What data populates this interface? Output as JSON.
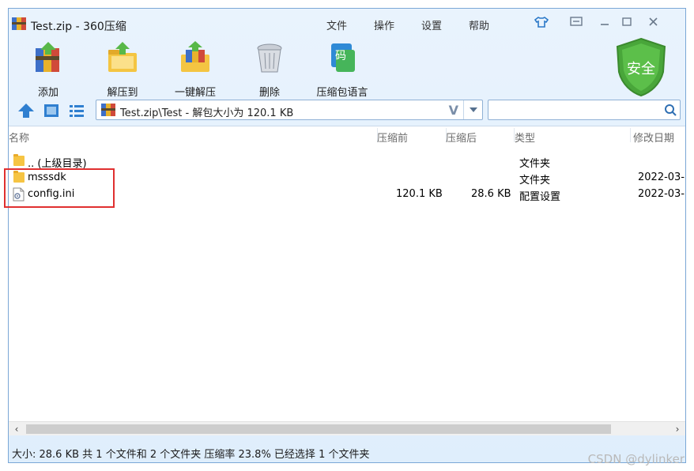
{
  "window": {
    "title": "Test.zip - 360压缩",
    "menu": [
      "文件",
      "操作",
      "设置",
      "帮助"
    ]
  },
  "toolbar": {
    "add": "添加",
    "extract_to": "解压到",
    "one_click_extract": "一键解压",
    "delete": "删除",
    "compress_language": "压缩包语言",
    "security_badge": "安全"
  },
  "address_bar": {
    "path": "Test.zip\\Test - 解包大小为 120.1 KB",
    "v_marker": "V",
    "search_placeholder": ""
  },
  "columns": {
    "name": "名称",
    "before": "压缩前",
    "after": "压缩后",
    "type": "类型",
    "modified": "修改日期"
  },
  "files": [
    {
      "name": ".. (上级目录)",
      "before": "",
      "after": "",
      "type": "文件夹",
      "modified": "",
      "icon": "folder-icon"
    },
    {
      "name": "msssdk",
      "before": "",
      "after": "",
      "type": "文件夹",
      "modified": "2022-03-",
      "icon": "folder-icon"
    },
    {
      "name": "config.ini",
      "before": "120.1 KB",
      "after": "28.6 KB",
      "type": "配置设置",
      "modified": "2022-03-",
      "icon": "ini-file-icon"
    }
  ],
  "status": {
    "text": "大小: 28.6 KB 共 1 个文件和 2 个文件夹 压缩率 23.8% 已经选择 1 个文件夹"
  },
  "watermark": "CSDN @dylinker",
  "colors": {
    "accent": "#2f7fd0",
    "highlight_box": "#e03030",
    "shield_green": "#49a63a"
  }
}
